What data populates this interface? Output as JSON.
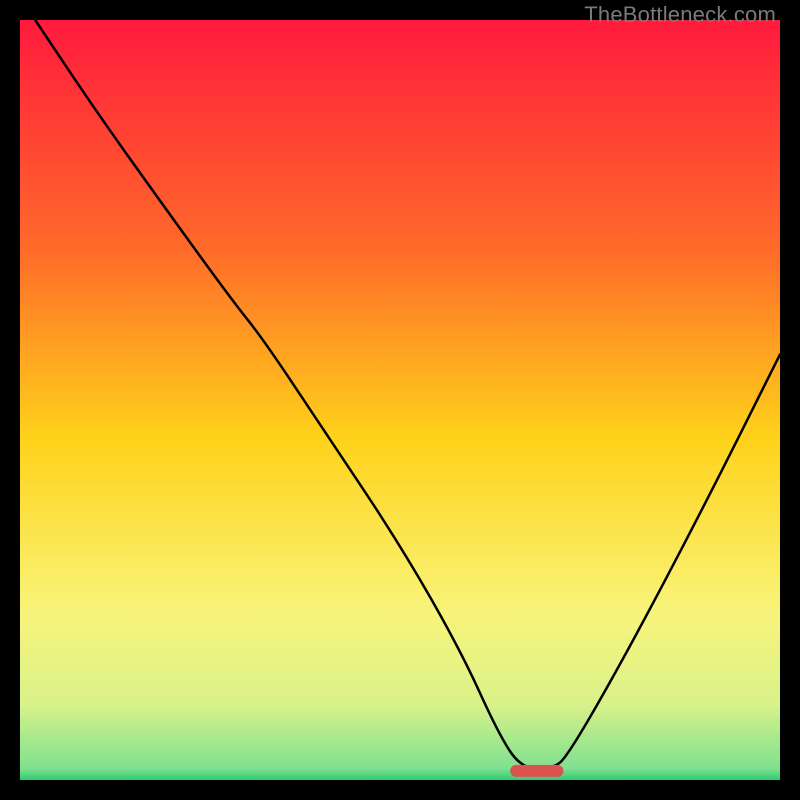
{
  "watermark": "TheBottleneck.com",
  "colors": {
    "top": "#ff1a3d",
    "upper_mid": "#ff6a2a",
    "mid": "#ffd21a",
    "lower_mid": "#f8f47a",
    "near_bottom": "#d9f28a",
    "bottom_green": "#2ecc71",
    "curve": "#000000",
    "marker": "#d9534f",
    "frame": "#000000"
  },
  "chart_data": {
    "type": "line",
    "title": "",
    "xlabel": "",
    "ylabel": "",
    "xlim": [
      0,
      100
    ],
    "ylim": [
      0,
      100
    ],
    "series": [
      {
        "name": "bottleneck-curve",
        "x": [
          2,
          10,
          20,
          28,
          32,
          40,
          50,
          58,
          63,
          66,
          70,
          72,
          80,
          90,
          100
        ],
        "y": [
          100,
          88,
          74,
          63,
          58,
          46,
          31,
          17,
          6,
          1.5,
          1.5,
          3,
          17,
          36,
          56
        ]
      }
    ],
    "marker": {
      "x_center": 68,
      "x_halfwidth": 3.5,
      "y": 1.2
    },
    "gradient_stops": [
      {
        "offset": 0.0,
        "color": "#ff1a3d"
      },
      {
        "offset": 0.3,
        "color": "#ff6a2a"
      },
      {
        "offset": 0.55,
        "color": "#ffd21a"
      },
      {
        "offset": 0.78,
        "color": "#f8f47a"
      },
      {
        "offset": 0.9,
        "color": "#d9f28a"
      },
      {
        "offset": 0.985,
        "color": "#7fe08f"
      },
      {
        "offset": 1.0,
        "color": "#2ecc71"
      }
    ]
  }
}
